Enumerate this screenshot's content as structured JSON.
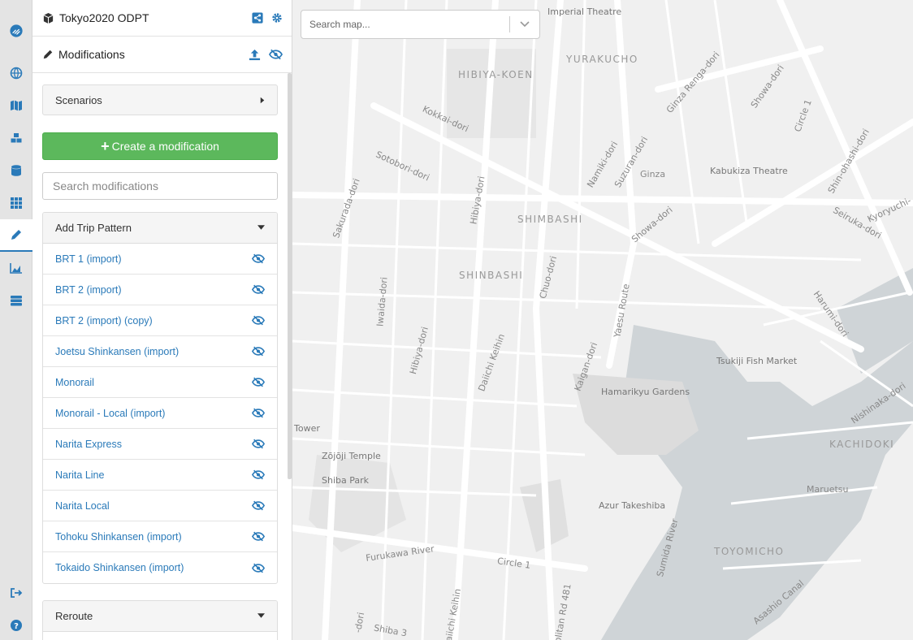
{
  "project": {
    "title": "Tokyo2020 ODPT",
    "icon": "cube-icon"
  },
  "modifications_header": {
    "title": "Modifications",
    "icon": "pencil-icon"
  },
  "scenarios": {
    "label": "Scenarios"
  },
  "create_button": {
    "label": "Create a modification"
  },
  "search": {
    "placeholder": "Search modifications"
  },
  "groups": [
    {
      "label": "Add Trip Pattern",
      "items": [
        {
          "label": "BRT 1 (import)"
        },
        {
          "label": "BRT 2 (import)"
        },
        {
          "label": "BRT 2 (import) (copy)"
        },
        {
          "label": "Joetsu Shinkansen (import)"
        },
        {
          "label": "Monorail"
        },
        {
          "label": "Monorail - Local (import)"
        },
        {
          "label": "Narita Express"
        },
        {
          "label": "Narita Line"
        },
        {
          "label": "Narita Local"
        },
        {
          "label": "Tohoku Shinkansen (import)"
        },
        {
          "label": "Tokaido Shinkansen (import)"
        }
      ]
    },
    {
      "label": "Reroute"
    }
  ],
  "map": {
    "search_placeholder": "Search map...",
    "labels": [
      "Imperial Theatre",
      "YURAKUCHO",
      "HIBIYA-KOEN",
      "Kokkai-dori",
      "Sotobori-dori",
      "Sakurada-dori",
      "Hibiya-dori",
      "SHIMBASHI",
      "SHINBASHI",
      "Chuo-dori",
      "Iwaida-dori",
      "Hibiya-dori",
      "Daiichi Keihin",
      "Yaesu Route",
      "Kaigan-dori",
      "Ginza",
      "Kabukiza Theatre",
      "Namiki-dori",
      "Suzuran-dori",
      "Ginza Renga-dori",
      "Showa-dori",
      "Showa-dori",
      "Circle 1",
      "Shin-ohashi-dori",
      "Kyoryuchi-",
      "Seiruka-dori",
      "Harumi-dori",
      "Tsukiji Fish Market",
      "Hamarikyu Gardens",
      "Tower",
      "Zōjōji Temple",
      "Shiba Park",
      "Azur Takeshiba",
      "Sumida River",
      "TOYOMICHO",
      "KACHIDOKI",
      "Maruetsu",
      "Nishinaka-dori",
      "Asashio Canal",
      "Furukawa River",
      "Circle 1",
      "Shiba 3",
      "Daiichi Keihin",
      "-dori",
      "politan Rd 481"
    ]
  },
  "colors": {
    "accent": "#2a7ab9",
    "success": "#5cb85c",
    "water": "#cfd4d7",
    "park": "#dcdcdc"
  }
}
